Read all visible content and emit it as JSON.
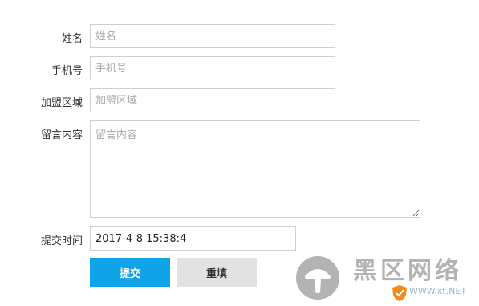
{
  "form": {
    "name": {
      "label": "姓名",
      "placeholder": "姓名"
    },
    "phone": {
      "label": "手机号",
      "placeholder": "手机号"
    },
    "region": {
      "label": "加盟区域",
      "placeholder": "加盟区域"
    },
    "message": {
      "label": "留言内容",
      "placeholder": "留言内容"
    },
    "submit_time": {
      "label": "提交时间",
      "value": "2017-4-8 15:38:4"
    },
    "submit_label": "提交",
    "reset_label": "重填"
  },
  "watermark": {
    "title": "黑区网络",
    "sub": "WWW.xt.NET",
    "logo_icon": "mushroom-logo-icon",
    "shield_icon": "shield-icon"
  },
  "colors": {
    "submit_bg": "#10a3e8",
    "reset_bg": "#e2e2e2",
    "border": "#cfcfcf"
  }
}
